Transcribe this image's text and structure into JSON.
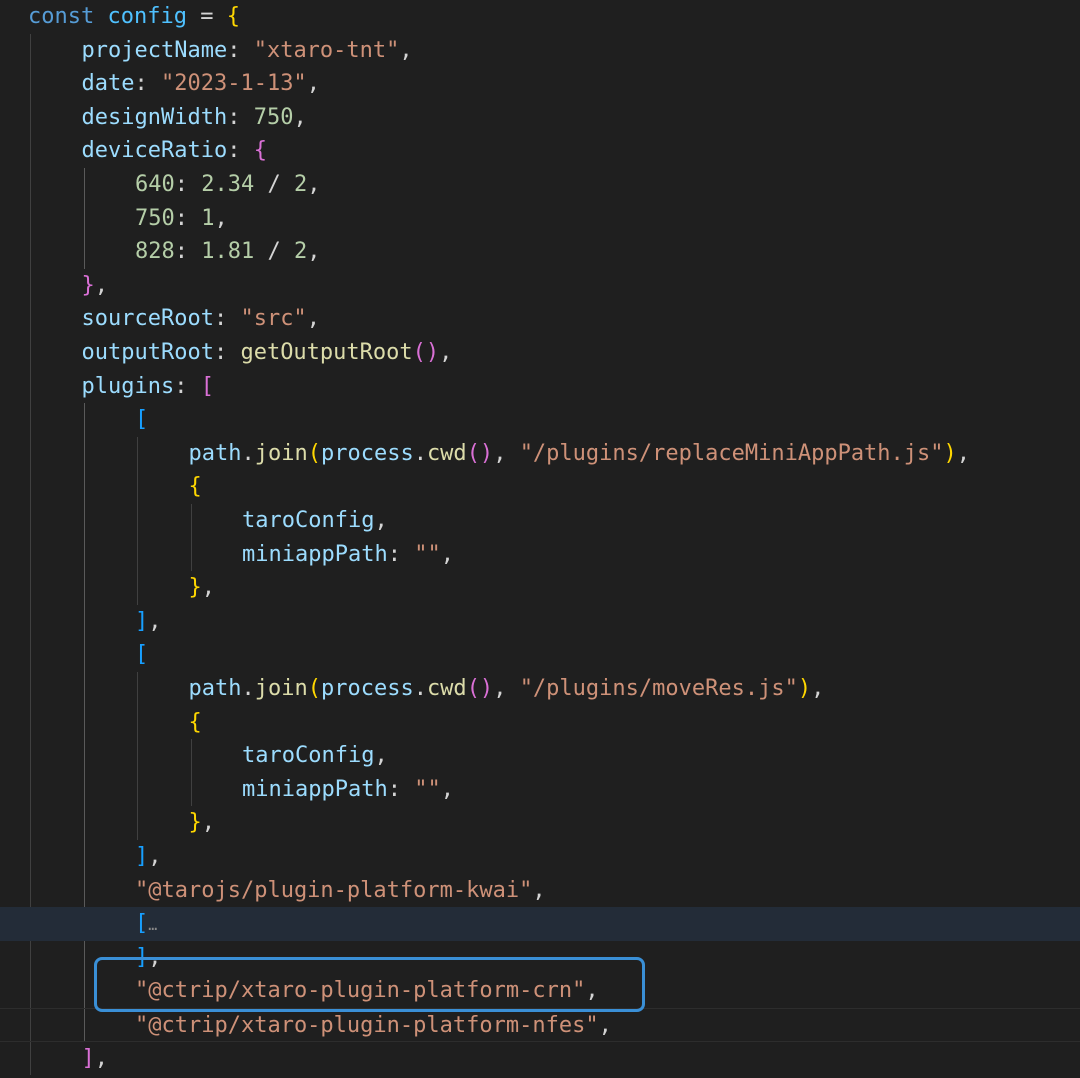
{
  "editor": {
    "colors": {
      "background": "#1f1f1f",
      "keyword": "#569cd6",
      "property": "#9cdcfe",
      "string": "#ce9178",
      "number": "#b5cea8",
      "function": "#dcdcaa",
      "bracket_level_1": "#ffd700",
      "bracket_level_2": "#da70d6",
      "bracket_level_3": "#179fff",
      "highlight_box": "#3a8fd6"
    },
    "fold_icon": "chevron-right-icon",
    "lines": [
      {
        "indent": 0,
        "tokens": [
          [
            "kw",
            "const"
          ],
          [
            "pn",
            " "
          ],
          [
            "var",
            "config"
          ],
          [
            "pn",
            " = "
          ],
          [
            "b1",
            "{"
          ]
        ]
      },
      {
        "indent": 1,
        "tokens": [
          [
            "prop",
            "projectName"
          ],
          [
            "pn",
            ": "
          ],
          [
            "str",
            "\"xtaro-tnt\""
          ],
          [
            "pn",
            ","
          ]
        ]
      },
      {
        "indent": 1,
        "tokens": [
          [
            "prop",
            "date"
          ],
          [
            "pn",
            ": "
          ],
          [
            "str",
            "\"2023-1-13\""
          ],
          [
            "pn",
            ","
          ]
        ]
      },
      {
        "indent": 1,
        "tokens": [
          [
            "prop",
            "designWidth"
          ],
          [
            "pn",
            ": "
          ],
          [
            "num",
            "750"
          ],
          [
            "pn",
            ","
          ]
        ]
      },
      {
        "indent": 1,
        "tokens": [
          [
            "prop",
            "deviceRatio"
          ],
          [
            "pn",
            ": "
          ],
          [
            "b2",
            "{"
          ]
        ]
      },
      {
        "indent": 2,
        "tokens": [
          [
            "num",
            "640"
          ],
          [
            "pn",
            ": "
          ],
          [
            "num",
            "2.34"
          ],
          [
            "pn",
            " / "
          ],
          [
            "num",
            "2"
          ],
          [
            "pn",
            ","
          ]
        ]
      },
      {
        "indent": 2,
        "tokens": [
          [
            "num",
            "750"
          ],
          [
            "pn",
            ": "
          ],
          [
            "num",
            "1"
          ],
          [
            "pn",
            ","
          ]
        ]
      },
      {
        "indent": 2,
        "tokens": [
          [
            "num",
            "828"
          ],
          [
            "pn",
            ": "
          ],
          [
            "num",
            "1.81"
          ],
          [
            "pn",
            " / "
          ],
          [
            "num",
            "2"
          ],
          [
            "pn",
            ","
          ]
        ]
      },
      {
        "indent": 1,
        "tokens": [
          [
            "b2",
            "}"
          ],
          [
            "pn",
            ","
          ]
        ]
      },
      {
        "indent": 1,
        "tokens": [
          [
            "prop",
            "sourceRoot"
          ],
          [
            "pn",
            ": "
          ],
          [
            "str",
            "\"src\""
          ],
          [
            "pn",
            ","
          ]
        ]
      },
      {
        "indent": 1,
        "tokens": [
          [
            "prop",
            "outputRoot"
          ],
          [
            "pn",
            ": "
          ],
          [
            "fn",
            "getOutputRoot"
          ],
          [
            "b2",
            "()"
          ],
          [
            "pn",
            ","
          ]
        ]
      },
      {
        "indent": 1,
        "tokens": [
          [
            "prop",
            "plugins"
          ],
          [
            "pn",
            ": "
          ],
          [
            "b2",
            "["
          ]
        ]
      },
      {
        "indent": 2,
        "tokens": [
          [
            "b3",
            "["
          ]
        ]
      },
      {
        "indent": 3,
        "tokens": [
          [
            "prop",
            "path"
          ],
          [
            "pn",
            "."
          ],
          [
            "fn",
            "join"
          ],
          [
            "b1",
            "("
          ],
          [
            "prop",
            "process"
          ],
          [
            "pn",
            "."
          ],
          [
            "fn",
            "cwd"
          ],
          [
            "b2",
            "()"
          ],
          [
            "pn",
            ", "
          ],
          [
            "str",
            "\"/plugins/replaceMiniAppPath.js\""
          ],
          [
            "b1",
            ")"
          ],
          [
            "pn",
            ","
          ]
        ]
      },
      {
        "indent": 3,
        "tokens": [
          [
            "b1",
            "{"
          ]
        ]
      },
      {
        "indent": 4,
        "tokens": [
          [
            "prop",
            "taroConfig"
          ],
          [
            "pn",
            ","
          ]
        ]
      },
      {
        "indent": 4,
        "tokens": [
          [
            "prop",
            "miniappPath"
          ],
          [
            "pn",
            ": "
          ],
          [
            "str",
            "\"\""
          ],
          [
            "pn",
            ","
          ]
        ]
      },
      {
        "indent": 3,
        "tokens": [
          [
            "b1",
            "}"
          ],
          [
            "pn",
            ","
          ]
        ]
      },
      {
        "indent": 2,
        "tokens": [
          [
            "b3",
            "]"
          ],
          [
            "pn",
            ","
          ]
        ]
      },
      {
        "indent": 2,
        "tokens": [
          [
            "b3",
            "["
          ]
        ]
      },
      {
        "indent": 3,
        "tokens": [
          [
            "prop",
            "path"
          ],
          [
            "pn",
            "."
          ],
          [
            "fn",
            "join"
          ],
          [
            "b1",
            "("
          ],
          [
            "prop",
            "process"
          ],
          [
            "pn",
            "."
          ],
          [
            "fn",
            "cwd"
          ],
          [
            "b2",
            "()"
          ],
          [
            "pn",
            ", "
          ],
          [
            "str",
            "\"/plugins/moveRes.js\""
          ],
          [
            "b1",
            ")"
          ],
          [
            "pn",
            ","
          ]
        ]
      },
      {
        "indent": 3,
        "tokens": [
          [
            "b1",
            "{"
          ]
        ]
      },
      {
        "indent": 4,
        "tokens": [
          [
            "prop",
            "taroConfig"
          ],
          [
            "pn",
            ","
          ]
        ]
      },
      {
        "indent": 4,
        "tokens": [
          [
            "prop",
            "miniappPath"
          ],
          [
            "pn",
            ": "
          ],
          [
            "str",
            "\"\""
          ],
          [
            "pn",
            ","
          ]
        ]
      },
      {
        "indent": 3,
        "tokens": [
          [
            "b1",
            "}"
          ],
          [
            "pn",
            ","
          ]
        ]
      },
      {
        "indent": 2,
        "tokens": [
          [
            "b3",
            "]"
          ],
          [
            "pn",
            ","
          ]
        ]
      },
      {
        "indent": 2,
        "tokens": [
          [
            "str",
            "\"@tarojs/plugin-platform-kwai\""
          ],
          [
            "pn",
            ","
          ]
        ]
      },
      {
        "indent": 2,
        "folded": true,
        "tokens": [
          [
            "b3",
            "["
          ],
          [
            "ellip",
            "…"
          ]
        ]
      },
      {
        "indent": 2,
        "tokens": [
          [
            "b3",
            "]"
          ],
          [
            "pn",
            ","
          ]
        ]
      },
      {
        "indent": 2,
        "highlighted": true,
        "tokens": [
          [
            "str",
            "\"@ctrip/xtaro-plugin-platform-crn\""
          ],
          [
            "pn",
            ","
          ]
        ]
      },
      {
        "indent": 2,
        "active": true,
        "tokens": [
          [
            "str",
            "\"@ctrip/xtaro-plugin-platform-nfes\""
          ],
          [
            "pn",
            ","
          ]
        ]
      },
      {
        "indent": 1,
        "tokens": [
          [
            "b2",
            "]"
          ],
          [
            "pn",
            ","
          ]
        ]
      }
    ]
  }
}
